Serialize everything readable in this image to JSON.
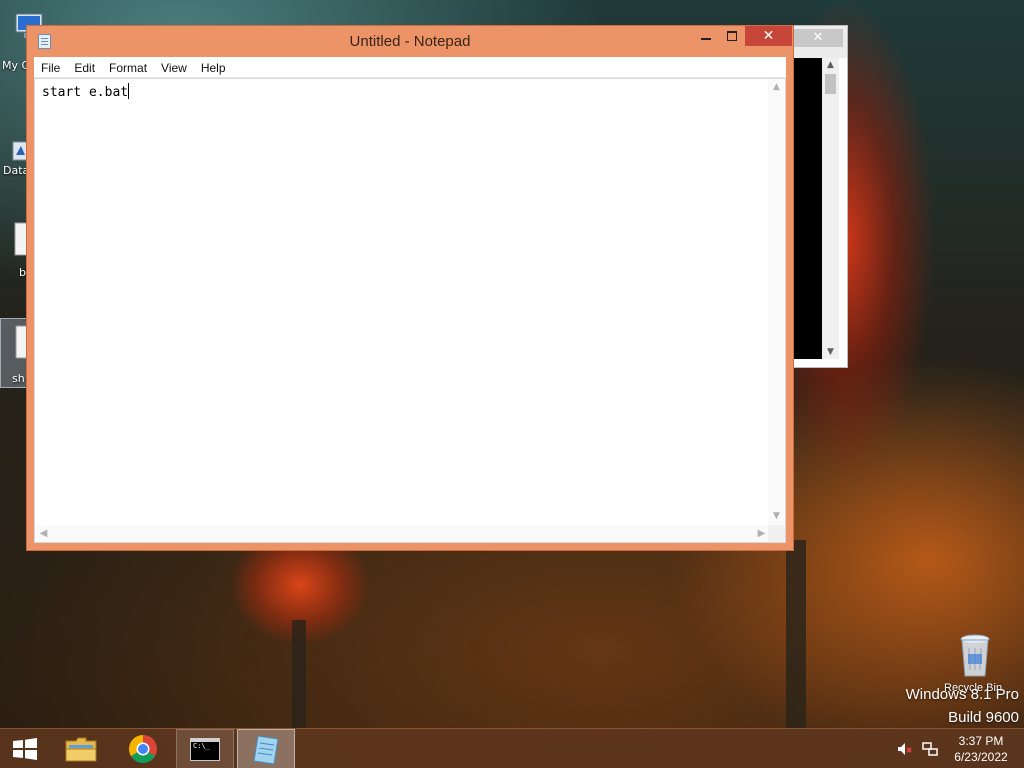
{
  "desktop": {
    "icons": [
      {
        "label": "My C"
      },
      {
        "label": "Data"
      },
      {
        "label": "b"
      },
      {
        "label": "sh"
      }
    ],
    "recycle_bin_label": "Recycle Bin",
    "watermark": {
      "line1": "Windows 8.1 Pro",
      "line2": "Build 9600"
    }
  },
  "background_window": {
    "close_glyph": "✕",
    "scroll_up": "▲",
    "scroll_down": "▼"
  },
  "notepad": {
    "title": "Untitled - Notepad",
    "menu": [
      "File",
      "Edit",
      "Format",
      "View",
      "Help"
    ],
    "content": "start e.bat",
    "controls": {
      "close_glyph": "✕"
    },
    "scroll": {
      "up": "▲",
      "down": "▼",
      "left": "◀",
      "right": "▶"
    }
  },
  "taskbar": {
    "apps": [
      {
        "name": "File Explorer",
        "icon": "folder-icon"
      },
      {
        "name": "Google Chrome",
        "icon": "chrome-icon"
      },
      {
        "name": "Command Prompt",
        "icon": "cmd-icon",
        "cmd_text": "C:\\_"
      },
      {
        "name": "Notepad",
        "icon": "notepad-icon",
        "active": true
      }
    ],
    "clock": {
      "time": "3:37 PM",
      "date": "6/23/2022"
    }
  },
  "colors": {
    "notepad_frame": "#ec9467",
    "close_button": "#c7463a",
    "taskbar": "#5f371e"
  }
}
